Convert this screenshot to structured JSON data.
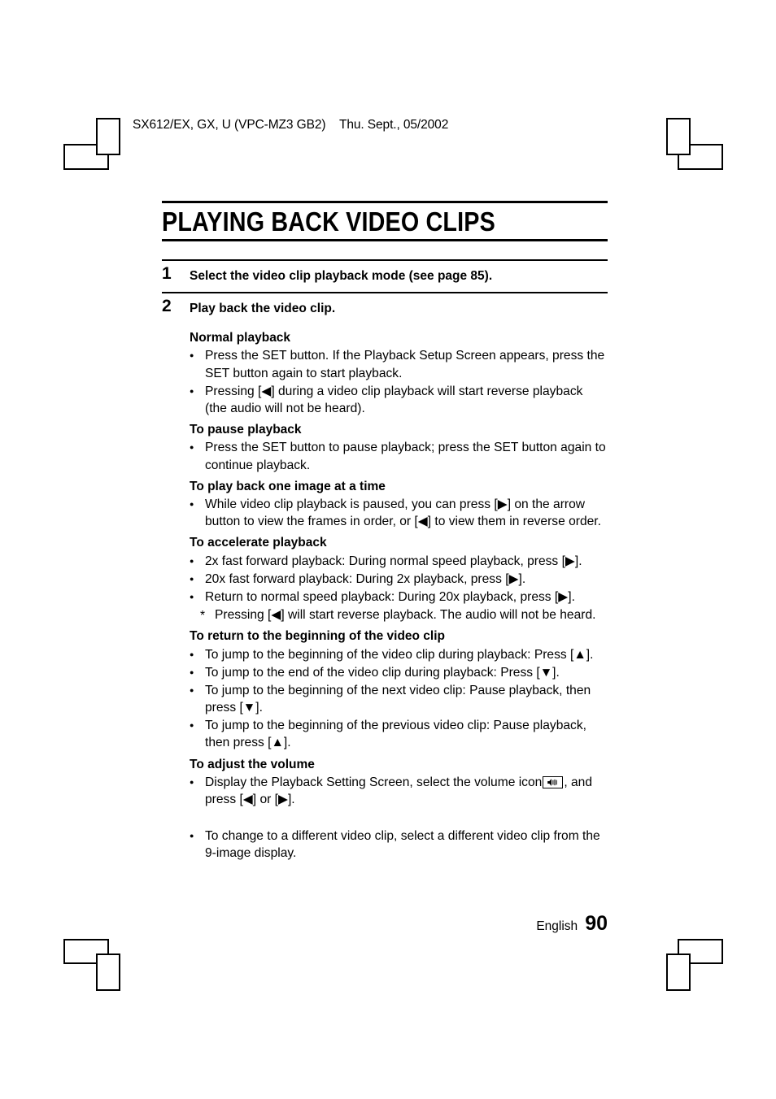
{
  "header": {
    "running_head": "SX612/EX, GX, U (VPC-MZ3 GB2)    Thu. Sept., 05/2002"
  },
  "title": "PLAYING BACK VIDEO CLIPS",
  "steps": [
    {
      "number": "1",
      "title": "Select the video clip playback mode (see page 85)."
    },
    {
      "number": "2",
      "title": "Play back the video clip."
    }
  ],
  "sections": [
    {
      "heading": "Normal playback",
      "bullets": [
        "Press the SET button. If the Playback Setup Screen appears, press the SET button again to start playback.",
        "Pressing [◀] during a video clip playback will start reverse playback (the audio will not be heard)."
      ]
    },
    {
      "heading": "To pause playback",
      "bullets": [
        "Press the SET button to pause playback; press the SET button again to continue playback."
      ]
    },
    {
      "heading": "To play back one image at a time",
      "bullets": [
        "While video clip playback is paused, you can press [▶] on the arrow button to view the frames in order, or [◀] to view them in reverse order."
      ]
    },
    {
      "heading": "To accelerate playback",
      "bullets": [
        "2x fast forward playback: During normal speed playback, press [▶].",
        "20x fast forward playback: During 2x playback, press [▶].",
        "Return to normal speed playback: During 20x playback, press [▶]."
      ],
      "note": "Pressing [◀] will start reverse playback. The audio will not be heard."
    },
    {
      "heading": "To return to the beginning of the video clip",
      "bullets": [
        "To jump to the beginning of the video clip during playback: Press [▲].",
        "To jump to the end of the video clip during playback: Press [▼].",
        "To jump to the beginning of the next video clip: Pause playback, then press [▼].",
        "To jump to the beginning of the previous video clip: Pause playback, then press [▲]."
      ]
    },
    {
      "heading": "To adjust the volume",
      "volume_bullet": {
        "text_before": "Display the Playback Setting Screen, select the volume icon",
        "icon": "volume-speaker-icon",
        "text_after": ", and press [◀] or [▶]."
      }
    }
  ],
  "closing_bullet": "To change to a different video clip, select a different video clip from the 9-image display.",
  "footer": {
    "language": "English",
    "page_number": "90"
  },
  "marks": {
    "top_left": "crop-mark",
    "top_right": "crop-mark",
    "bottom_left": "crop-mark",
    "bottom_right": "crop-mark"
  }
}
